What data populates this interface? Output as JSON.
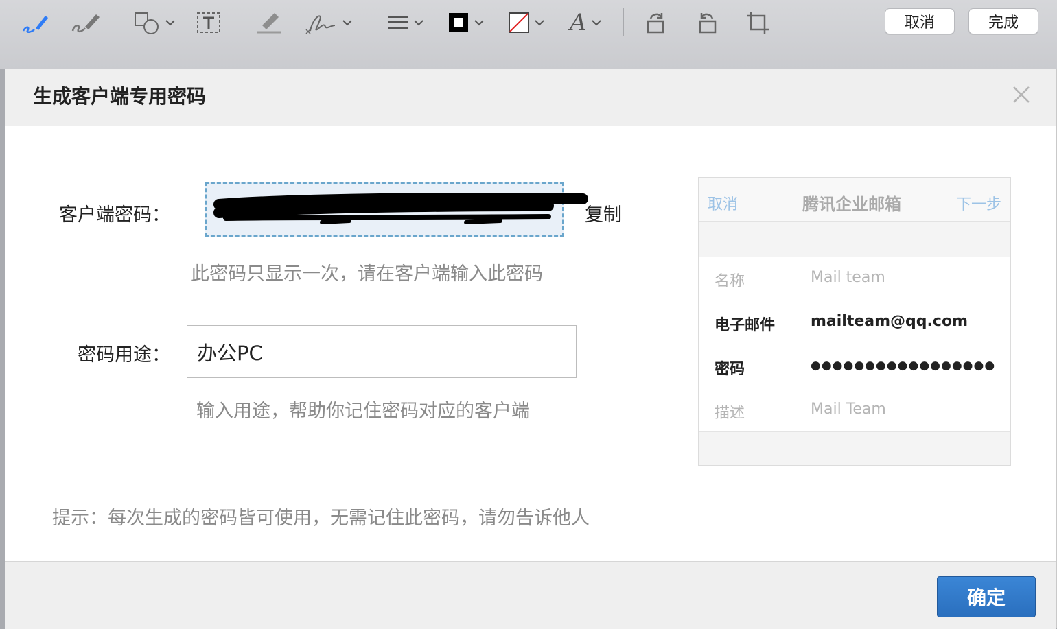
{
  "toolbar": {
    "cancel_label": "取消",
    "done_label": "完成",
    "icons": [
      "sketch-icon",
      "draw-icon",
      "shapes-icon",
      "text-box-icon",
      "highlight-icon",
      "signature-icon",
      "line-style-icon",
      "border-color-icon",
      "fill-color-icon",
      "font-icon",
      "rotate-right-icon",
      "rotate-left-icon",
      "crop-icon"
    ],
    "accent": "#2f7cf6"
  },
  "dialog": {
    "title": "生成客户端专用密码",
    "client_password_label": "客户端密码：",
    "copy_label": "复制",
    "password_hint": "此密码只显示一次，请在客户端输入此密码",
    "purpose_label": "密码用途：",
    "purpose_value": "办公PC",
    "purpose_hint": "输入用途，帮助你记住密码对应的客户端",
    "tip": "提示：每次生成的密码皆可使用，无需记住此密码，请勿告诉他人",
    "ok_label": "确定"
  },
  "preview": {
    "cancel": "取消",
    "title": "腾讯企业邮箱",
    "next": "下一步",
    "rows": [
      {
        "key": "名称",
        "value": "Mail team"
      },
      {
        "key": "电子邮件",
        "value": "mailteam@qq.com"
      },
      {
        "key": "密码",
        "value": "●●●●●●●●●●●●●●●●●"
      },
      {
        "key": "描述",
        "value": "Mail Team"
      }
    ]
  },
  "colors": {
    "button_blue": "#2a6fbe",
    "dashed_border": "#6aa6cc",
    "hint_gray": "#8a8a8a"
  }
}
